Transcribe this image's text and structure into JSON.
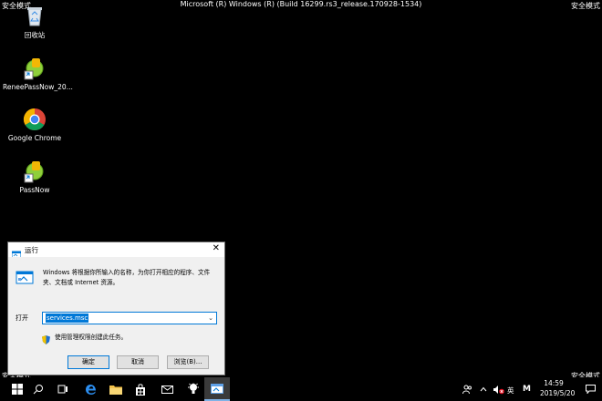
{
  "corners": {
    "top_left": "安全模式",
    "top_right": "安全模式",
    "bottom_left": "安全模式",
    "bottom_right": "安全模式"
  },
  "build_title": "Microsoft (R) Windows (R) (Build 16299.rs3_release.170928-1534)",
  "desktop_icons": [
    {
      "label": "回收站",
      "icon": "recycle-bin-icon"
    },
    {
      "label": "ReneePassNow_20...",
      "icon": "reneepassnow-icon"
    },
    {
      "label": "Google Chrome",
      "icon": "chrome-icon"
    },
    {
      "label": "PassNow",
      "icon": "passnow-icon"
    }
  ],
  "run_dialog": {
    "title": "运行",
    "description": "Windows 将根据你所输入的名称，为你打开相应的程序、文件夹、文档或 Internet 资源。",
    "open_label": "打开",
    "open_value": "services.msc",
    "admin_note": "使用管理权限创建此任务。",
    "buttons": {
      "ok": "确定",
      "cancel": "取消",
      "browse": "浏览(B)..."
    }
  },
  "taskbar": {
    "clock_time": "14:59",
    "clock_date": "2019/5/20",
    "ime_mode": "英",
    "ime_letter": "M",
    "accent": "#0078d7"
  }
}
